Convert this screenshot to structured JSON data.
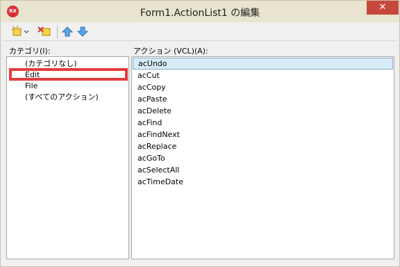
{
  "window": {
    "title": "Form1.ActionList1 の編集",
    "app_icon_text": "RX",
    "close_glyph": "✕"
  },
  "toolbar": {
    "buttons": [
      {
        "name": "new-action",
        "icon": "new-action-icon"
      },
      {
        "name": "delete-action",
        "icon": "delete-action-icon"
      },
      {
        "name": "move-up",
        "icon": "arrow-up-icon"
      },
      {
        "name": "move-down",
        "icon": "arrow-down-icon"
      }
    ]
  },
  "categories": {
    "label": "カテゴリ(I):",
    "items": [
      "(カテゴリなし)",
      "Edit",
      "File",
      "(すべてのアクション)"
    ],
    "selected": "Edit"
  },
  "actions": {
    "label": "アクション (VCL)(A):",
    "items": [
      "acUndo",
      "acCut",
      "acCopy",
      "acPaste",
      "acDelete",
      "acFind",
      "acFindNext",
      "acReplace",
      "acGoTo",
      "acSelectAll",
      "acTimeDate"
    ],
    "selected": "acUndo"
  },
  "colors": {
    "title_bar": "#e8e4cf",
    "close_button": "#c7473c",
    "highlight_outline": "#e53b3b",
    "selection": "#d7ebf8"
  }
}
